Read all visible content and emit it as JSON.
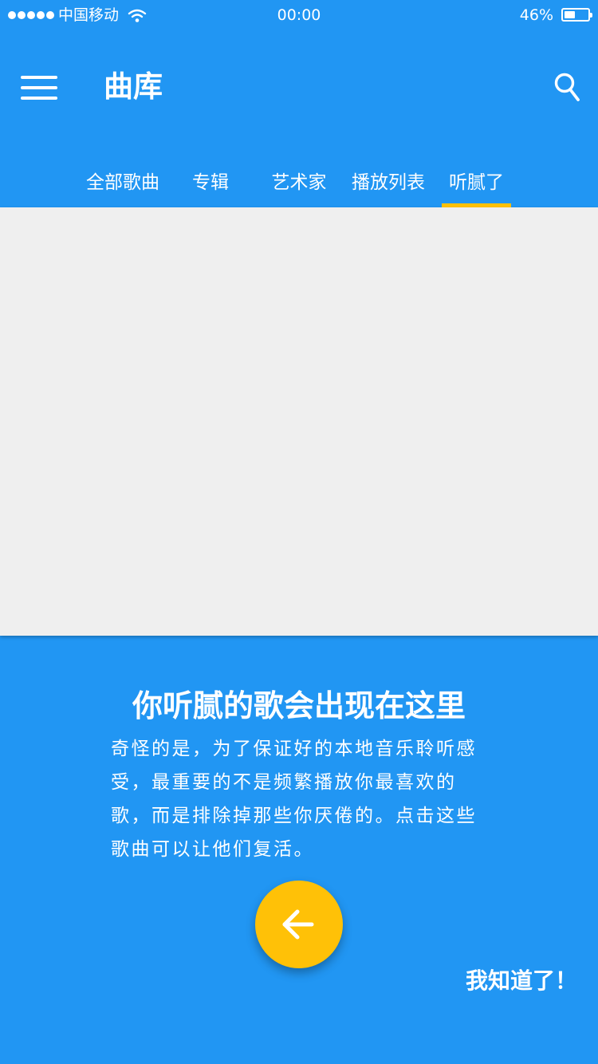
{
  "status_bar": {
    "carrier": "中国移动",
    "time": "00:00",
    "battery_percent_label": "46%",
    "battery_level": 0.46,
    "icons": [
      "signal-dots-icon",
      "wifi-icon",
      "battery-icon"
    ]
  },
  "app_bar": {
    "title": "曲库",
    "icons": [
      "menu-icon",
      "search-icon"
    ]
  },
  "tabs": [
    {
      "label": "全部歌曲",
      "selected": false
    },
    {
      "label": "专辑",
      "selected": false
    },
    {
      "label": "艺术家",
      "selected": false
    },
    {
      "label": "播放列表",
      "selected": false
    },
    {
      "label": "听腻了",
      "selected": true
    }
  ],
  "hint": {
    "title": "你听腻的歌会出现在这里",
    "body": "奇怪的是，为了保证好的本地音乐聆听感受，最重要的不是频繁播放你最喜欢的歌，而是排除掉那些你厌倦的。点击这些歌曲可以让他们复活。",
    "fab_icon": "arrow-left-icon",
    "dismiss_label": "我知道了！"
  },
  "colors": {
    "primary": "#2196f3",
    "accent": "#ffc107",
    "content_background": "#efefef",
    "text": "#ffffff"
  }
}
